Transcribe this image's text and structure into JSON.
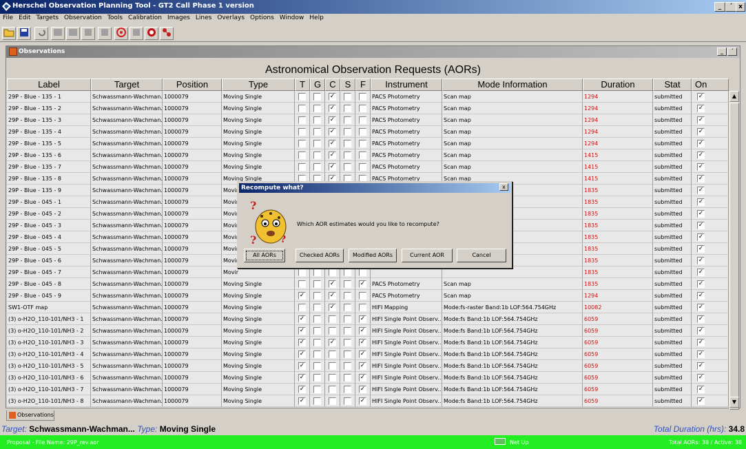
{
  "app": {
    "title": "Herschel Observation Planning Tool - GT2 Call Phase 1 version",
    "window_buttons": [
      "_",
      "´",
      "x"
    ]
  },
  "menu": [
    "File",
    "Edit",
    "Targets",
    "Observation",
    "Tools",
    "Calibration",
    "Images",
    "Lines",
    "Overlays",
    "Options",
    "Window",
    "Help"
  ],
  "internal_frame": {
    "title": "Observations",
    "heading": "Astronomical Observation Requests (AORs)"
  },
  "table": {
    "columns": [
      "Label",
      "Target",
      "Position",
      "Type",
      "T",
      "G",
      "C",
      "S",
      "F",
      "Instrument",
      "Mode Information",
      "Duration",
      "Stat",
      "On"
    ],
    "rows": [
      {
        "label": "29P - Blue - 135 - 1",
        "target": "Schwassmann-Wachman...",
        "position": "1000079",
        "type": "Moving Single",
        "T": false,
        "G": false,
        "C": true,
        "S": false,
        "F": false,
        "instrument": "PACS Photometry",
        "mode": "Scan map",
        "duration": "1294",
        "stat": "submitted",
        "on": true
      },
      {
        "label": "29P - Blue - 135 - 2",
        "target": "Schwassmann-Wachman...",
        "position": "1000079",
        "type": "Moving Single",
        "T": false,
        "G": false,
        "C": true,
        "S": false,
        "F": false,
        "instrument": "PACS Photometry",
        "mode": "Scan map",
        "duration": "1294",
        "stat": "submitted",
        "on": true
      },
      {
        "label": "29P - Blue - 135 - 3",
        "target": "Schwassmann-Wachman...",
        "position": "1000079",
        "type": "Moving Single",
        "T": false,
        "G": false,
        "C": true,
        "S": false,
        "F": false,
        "instrument": "PACS Photometry",
        "mode": "Scan map",
        "duration": "1294",
        "stat": "submitted",
        "on": true
      },
      {
        "label": "29P - Blue - 135 - 4",
        "target": "Schwassmann-Wachman...",
        "position": "1000079",
        "type": "Moving Single",
        "T": false,
        "G": false,
        "C": true,
        "S": false,
        "F": false,
        "instrument": "PACS Photometry",
        "mode": "Scan map",
        "duration": "1294",
        "stat": "submitted",
        "on": true
      },
      {
        "label": "29P - Blue - 135 - 5",
        "target": "Schwassmann-Wachman...",
        "position": "1000079",
        "type": "Moving Single",
        "T": false,
        "G": false,
        "C": true,
        "S": false,
        "F": false,
        "instrument": "PACS Photometry",
        "mode": "Scan map",
        "duration": "1294",
        "stat": "submitted",
        "on": true
      },
      {
        "label": "29P - Blue - 135 - 6",
        "target": "Schwassmann-Wachman...",
        "position": "1000079",
        "type": "Moving Single",
        "T": false,
        "G": false,
        "C": true,
        "S": false,
        "F": false,
        "instrument": "PACS Photometry",
        "mode": "Scan map",
        "duration": "1415",
        "stat": "submitted",
        "on": true
      },
      {
        "label": "29P - Blue - 135 - 7",
        "target": "Schwassmann-Wachman...",
        "position": "1000079",
        "type": "Moving Single",
        "T": false,
        "G": false,
        "C": true,
        "S": false,
        "F": false,
        "instrument": "PACS Photometry",
        "mode": "Scan map",
        "duration": "1415",
        "stat": "submitted",
        "on": true
      },
      {
        "label": "29P - Blue - 135 - 8",
        "target": "Schwassmann-Wachman...",
        "position": "1000079",
        "type": "Moving Single",
        "T": false,
        "G": false,
        "C": true,
        "S": false,
        "F": false,
        "instrument": "PACS Photometry",
        "mode": "Scan map",
        "duration": "1415",
        "stat": "submitted",
        "on": true
      },
      {
        "label": "29P - Blue - 135 - 9",
        "target": "Schwassmann-Wachman...",
        "position": "1000079",
        "type": "Movir",
        "T": false,
        "G": false,
        "C": false,
        "S": false,
        "F": false,
        "instrument": "",
        "mode": "",
        "duration": "1835",
        "stat": "submitted",
        "on": true
      },
      {
        "label": "29P - Blue - 045 - 1",
        "target": "Schwassmann-Wachman...",
        "position": "1000079",
        "type": "Movir",
        "T": false,
        "G": false,
        "C": false,
        "S": false,
        "F": false,
        "instrument": "",
        "mode": "",
        "duration": "1835",
        "stat": "submitted",
        "on": true
      },
      {
        "label": "29P - Blue - 045 - 2",
        "target": "Schwassmann-Wachman...",
        "position": "1000079",
        "type": "Movir",
        "T": false,
        "G": false,
        "C": false,
        "S": false,
        "F": false,
        "instrument": "",
        "mode": "",
        "duration": "1835",
        "stat": "submitted",
        "on": true
      },
      {
        "label": "29P - Blue - 045 - 3",
        "target": "Schwassmann-Wachman...",
        "position": "1000079",
        "type": "Movir",
        "T": false,
        "G": false,
        "C": false,
        "S": false,
        "F": false,
        "instrument": "",
        "mode": "",
        "duration": "1835",
        "stat": "submitted",
        "on": true
      },
      {
        "label": "29P - Blue - 045 - 4",
        "target": "Schwassmann-Wachman...",
        "position": "1000079",
        "type": "Movir",
        "T": false,
        "G": false,
        "C": false,
        "S": false,
        "F": false,
        "instrument": "",
        "mode": "",
        "duration": "1835",
        "stat": "submitted",
        "on": true
      },
      {
        "label": "29P - Blue - 045 - 5",
        "target": "Schwassmann-Wachman...",
        "position": "1000079",
        "type": "Movir",
        "T": false,
        "G": false,
        "C": false,
        "S": false,
        "F": false,
        "instrument": "",
        "mode": "",
        "duration": "1835",
        "stat": "submitted",
        "on": true
      },
      {
        "label": "29P - Blue - 045 - 6",
        "target": "Schwassmann-Wachman...",
        "position": "1000079",
        "type": "Movir",
        "T": false,
        "G": false,
        "C": false,
        "S": false,
        "F": false,
        "instrument": "",
        "mode": "",
        "duration": "1835",
        "stat": "submitted",
        "on": true
      },
      {
        "label": "29P - Blue - 045 - 7",
        "target": "Schwassmann-Wachman...",
        "position": "1000079",
        "type": "Movir",
        "T": false,
        "G": false,
        "C": false,
        "S": false,
        "F": false,
        "instrument": "",
        "mode": "",
        "duration": "1835",
        "stat": "submitted",
        "on": true
      },
      {
        "label": "29P - Blue - 045 - 8",
        "target": "Schwassmann-Wachman...",
        "position": "1000079",
        "type": "Moving Single",
        "T": false,
        "G": false,
        "C": true,
        "S": false,
        "F": true,
        "instrument": "PACS Photometry",
        "mode": "Scan map",
        "duration": "1835",
        "stat": "submitted",
        "on": true
      },
      {
        "label": "29P - Blue - 045 - 9",
        "target": "Schwassmann-Wachman...",
        "position": "1000079",
        "type": "Moving Single",
        "T": true,
        "G": false,
        "C": true,
        "S": false,
        "F": false,
        "instrument": "PACS Photometry",
        "mode": "Scan map",
        "duration": "1294",
        "stat": "submitted",
        "on": true
      },
      {
        "label": "SW1-OTF map",
        "target": "Schwassmann-Wachman...",
        "position": "1000079",
        "type": "Moving Single",
        "T": false,
        "G": false,
        "C": true,
        "S": false,
        "F": false,
        "instrument": "HIFI Mapping",
        "mode": "Mode:fs-raster Band:1b LOF:564.754GHz",
        "duration": "10082",
        "stat": "submitted",
        "on": true
      },
      {
        "label": "(3) o-H2O_110-101/NH3 - 1",
        "target": "Schwassmann-Wachman...",
        "position": "1000079",
        "type": "Moving Single",
        "T": true,
        "G": false,
        "C": false,
        "S": false,
        "F": true,
        "instrument": "HIFI Single Point Observ...",
        "mode": "Mode:fs Band:1b LOF:564.754GHz",
        "duration": "6059",
        "stat": "submitted",
        "on": true
      },
      {
        "label": "(3) o-H2O_110-101/NH3 - 2",
        "target": "Schwassmann-Wachman...",
        "position": "1000079",
        "type": "Moving Single",
        "T": true,
        "G": false,
        "C": false,
        "S": false,
        "F": true,
        "instrument": "HIFI Single Point Observ...",
        "mode": "Mode:fs Band:1b LOF:564.754GHz",
        "duration": "6059",
        "stat": "submitted",
        "on": true
      },
      {
        "label": "(3) o-H2O_110-101/NH3 - 3",
        "target": "Schwassmann-Wachman...",
        "position": "1000079",
        "type": "Moving Single",
        "T": true,
        "G": false,
        "C": true,
        "S": false,
        "F": true,
        "instrument": "HIFI Single Point Observ...",
        "mode": "Mode:fs Band:1b LOF:564.754GHz",
        "duration": "6059",
        "stat": "submitted",
        "on": true
      },
      {
        "label": "(3) o-H2O_110-101/NH3 - 4",
        "target": "Schwassmann-Wachman...",
        "position": "1000079",
        "type": "Moving Single",
        "T": true,
        "G": false,
        "C": false,
        "S": false,
        "F": true,
        "instrument": "HIFI Single Point Observ...",
        "mode": "Mode:fs Band:1b LOF:564.754GHz",
        "duration": "6059",
        "stat": "submitted",
        "on": true
      },
      {
        "label": "(3) o-H2O_110-101/NH3 - 5",
        "target": "Schwassmann-Wachman...",
        "position": "1000079",
        "type": "Moving Single",
        "T": true,
        "G": false,
        "C": false,
        "S": false,
        "F": true,
        "instrument": "HIFI Single Point Observ...",
        "mode": "Mode:fs Band:1b LOF:564.754GHz",
        "duration": "6059",
        "stat": "submitted",
        "on": true
      },
      {
        "label": "(3) o-H2O_110-101/NH3 - 6",
        "target": "Schwassmann-Wachman...",
        "position": "1000079",
        "type": "Moving Single",
        "T": true,
        "G": false,
        "C": false,
        "S": false,
        "F": true,
        "instrument": "HIFI Single Point Observ...",
        "mode": "Mode:fs Band:1b LOF:564.754GHz",
        "duration": "6059",
        "stat": "submitted",
        "on": true
      },
      {
        "label": "(3) o-H2O_110-101/NH3 - 7",
        "target": "Schwassmann-Wachman...",
        "position": "1000079",
        "type": "Moving Single",
        "T": true,
        "G": false,
        "C": false,
        "S": false,
        "F": true,
        "instrument": "HIFI Single Point Observ...",
        "mode": "Mode:fs Band:1b LOF:564.754GHz",
        "duration": "6059",
        "stat": "submitted",
        "on": true
      },
      {
        "label": "(3) o-H2O_110-101/NH3 - 8",
        "target": "Schwassmann-Wachman...",
        "position": "1000079",
        "type": "Moving Single",
        "T": true,
        "G": false,
        "C": false,
        "S": false,
        "F": true,
        "instrument": "HIFI Single Point Observ...",
        "mode": "Mode:fs Band:1b LOF:564.754GHz",
        "duration": "6059",
        "stat": "submitted",
        "on": true
      }
    ]
  },
  "tabs": {
    "observations": "Observations"
  },
  "status": {
    "target_label": "Target:",
    "target_value": "Schwassmann-Wachman...",
    "type_label": "Type:",
    "type_value": "Moving Single",
    "total_label": "Total Duration (hrs):",
    "total_value": "34.8",
    "proposal": "Proposal - File Name: 29P_rev.aor",
    "net": "Net Up",
    "aors": "Total AORs: 38 / Active: 38"
  },
  "dialog": {
    "title": "Recompute what?",
    "message": "Which AOR estimates would you like to recompute?",
    "buttons": [
      "All AORs",
      "Checked AORs",
      "Modified AORs",
      "Current AOR",
      "Cancel"
    ]
  },
  "colors": {
    "status_green": "#22ee22",
    "duration_red": "#d01010",
    "title_blue": "#0a246a"
  },
  "icons": [
    "app-icon",
    "new-icon",
    "save-icon",
    "undo-icon",
    "target-icon",
    "network-icon"
  ]
}
